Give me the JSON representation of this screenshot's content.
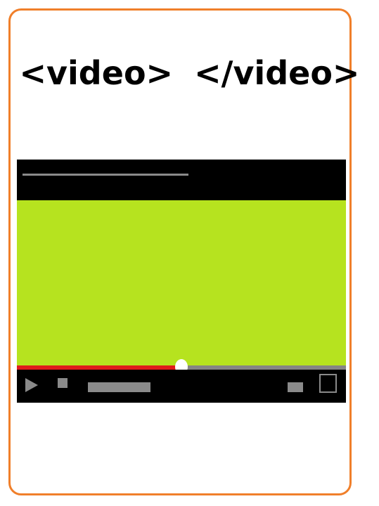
{
  "heading": {
    "open_tag": "<video>",
    "close_tag": "</video>"
  },
  "player": {
    "progress": 0.5,
    "colors": {
      "video_surface": "#b6e31f",
      "progress_played": "#e01b1b",
      "progress_remaining": "#858585",
      "card_border": "#f07f2a"
    },
    "icons": {
      "play": "play-icon",
      "stop": "stop-icon",
      "volume": "volume-icon",
      "fullscreen": "fullscreen-icon"
    }
  }
}
